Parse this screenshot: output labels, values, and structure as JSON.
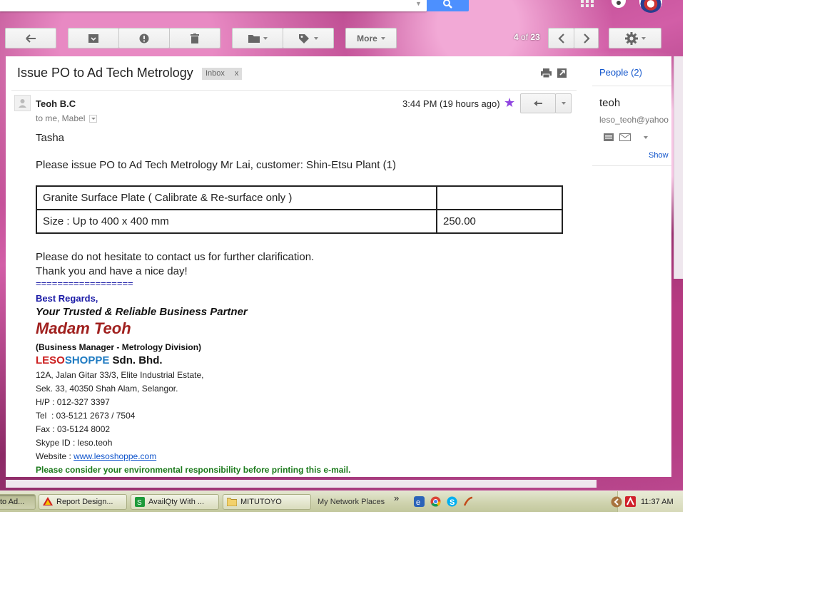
{
  "toolbar": {
    "more_label": "More",
    "pager_current": "4",
    "pager_of": "of",
    "pager_total": "23"
  },
  "message": {
    "subject": "Issue PO to Ad Tech Metrology",
    "label": "Inbox",
    "label_remove": "x",
    "sender": "Teoh B.C",
    "to_line": "to me, Mabel",
    "timestamp": "3:44 PM (19 hours ago)",
    "greeting": "Tasha",
    "intro": "Please issue PO to Ad Tech Metrology Mr Lai, customer:  Shin-Etsu Plant (1)",
    "table": [
      [
        "Granite Surface Plate ( Calibrate & Re-surface only )",
        ""
      ],
      [
        "Size : Up to 400 x 400 mm",
        "250.00"
      ]
    ],
    "closing1": "Please do not hesitate to contact us for further clarification.",
    "closing2": "Thank you and have a nice day!"
  },
  "signature": {
    "divider": "==================",
    "regards": "Best Regards,",
    "tagline": "Your Trusted & Reliable Business Partner",
    "name": "Madam Teoh",
    "title": "(Business Manager - Metrology Division)",
    "company_part1": "LESO",
    "company_part2": "SHOPPE",
    "company_part3": " Sdn. Bhd.",
    "address1": "12A, Jalan Gitar 33/3, Elite Industrial Estate,",
    "address2": "Sek. 33, 40350 Shah Alam, Selangor.",
    "hp": "H/P : 012-327 3397",
    "tel": "Tel  : 03-5121 2673 / 7504",
    "fax": "Fax : 03-5124 8002",
    "skype": "Skype ID : leso.teoh",
    "website_label": "Website : ",
    "website_url": "www.lesoshoppe.com",
    "eco": "Please consider your environmental responsibility before printing this e-mail.",
    "colors": {
      "leso": "#cc1f1f",
      "shoppe": "#1f7bc2",
      "regards": "#1a1aa6",
      "name": "#a0201e",
      "eco": "#1b7a1b"
    }
  },
  "people": {
    "title": "People (2)",
    "name": "teoh",
    "email": "leso_teoh@yahoo",
    "show": "Show"
  },
  "taskbar": {
    "tasks": [
      "to Ad...",
      "Report Design...",
      "AvailQty With ...",
      "MITUTOYO"
    ],
    "network": "My Network Places",
    "chevron": "»",
    "clock": "11:37 AM"
  },
  "colors": {
    "accent": "#4d90fe",
    "link": "#1155cc"
  }
}
